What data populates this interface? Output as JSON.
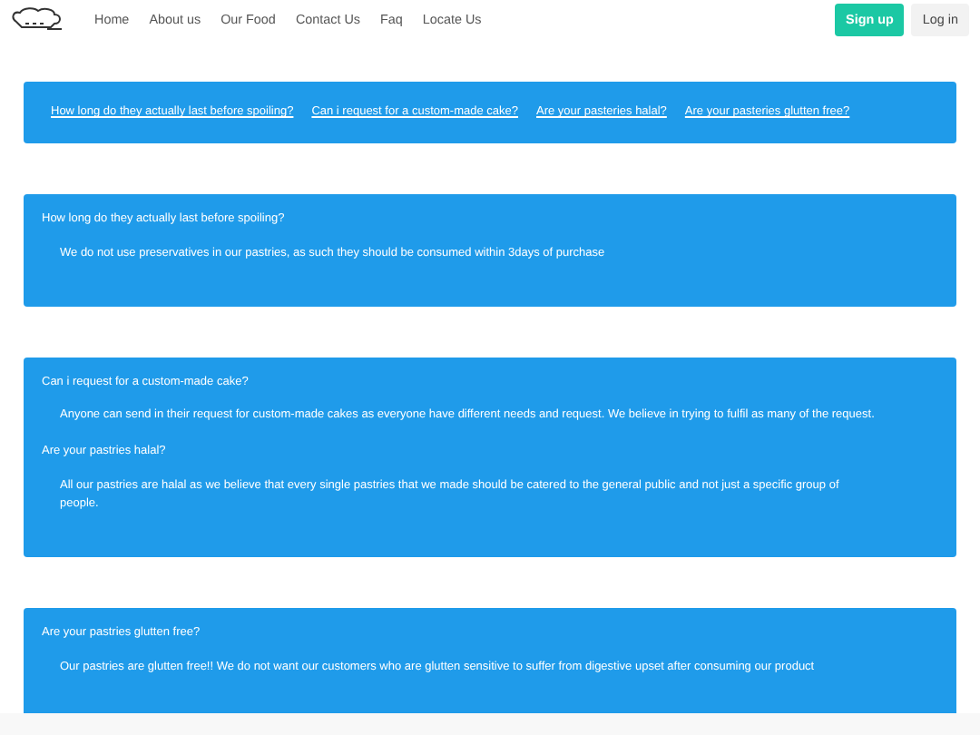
{
  "navbar": {
    "links": [
      "Home",
      "About us",
      "Our Food",
      "Contact Us",
      "Faq",
      "Locate Us"
    ],
    "signup": "Sign up",
    "login": "Log in"
  },
  "quick_links": [
    "How long do they actually last before spoiling?",
    "Can i request for a custom-made cake?",
    "Are your pasteries halal?",
    "Are your pasteries glutten free?"
  ],
  "sections": [
    {
      "items": [
        {
          "question": "How long do they actually last before spoiling?",
          "answer": "We do not use preservatives in our pastries, as such they should be consumed within 3days of purchase"
        }
      ]
    },
    {
      "items": [
        {
          "question": "Can i request for a custom-made cake?",
          "answer": "Anyone can send in their request for custom-made cakes as everyone have different needs and request. We believe in trying to fulfil as many of the request."
        },
        {
          "question": "Are your pastries halal?",
          "answer": "All our pastries are halal as we believe that every single pastries that we made should be catered to the general public and not just a specific group of people."
        }
      ]
    },
    {
      "items": [
        {
          "question": "Are your pastries glutten free?",
          "answer": "Our pastries are glutten free!! We do not want our customers who are glutten sensitive to suffer from digestive upset after consuming our product"
        }
      ]
    }
  ]
}
